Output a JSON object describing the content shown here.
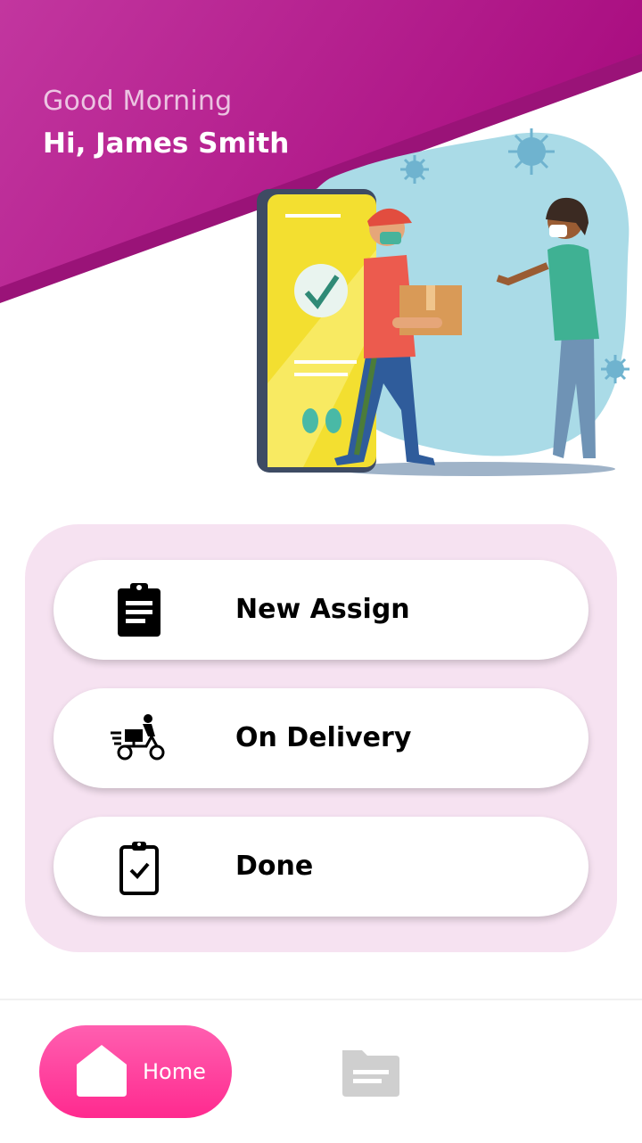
{
  "header": {
    "greeting": "Good Morning",
    "user_name": "Hi, James Smith",
    "gradient_start": "#c2369f",
    "gradient_end": "#a90d80"
  },
  "menu": {
    "panel_color": "#f6e2f1",
    "items": [
      {
        "label": "New Assign",
        "icon": "clipboard-list-icon"
      },
      {
        "label": "On Delivery",
        "icon": "delivery-scooter-icon"
      },
      {
        "label": "Done",
        "icon": "clipboard-check-icon"
      }
    ]
  },
  "bottom_nav": {
    "home_label": "Home",
    "home_icon": "home-icon",
    "files_icon": "folder-icon",
    "active_color": "#ff3d9a"
  }
}
